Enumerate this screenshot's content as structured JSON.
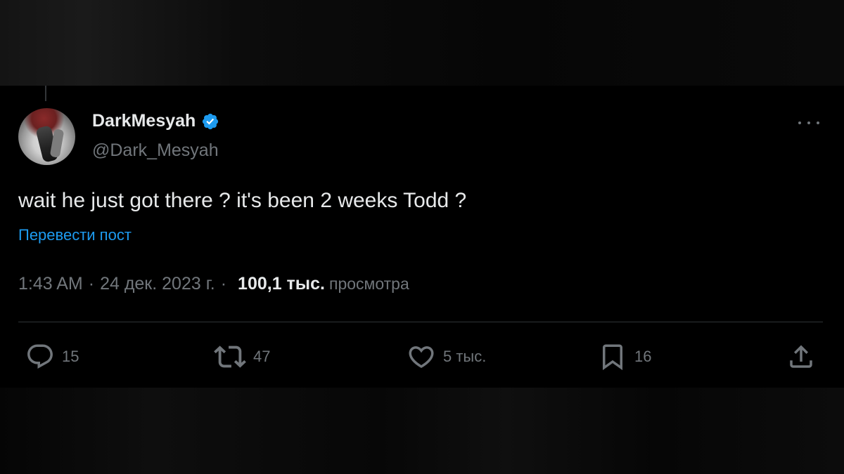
{
  "colors": {
    "background": "#000000",
    "text_primary": "#e7e9ea",
    "text_secondary": "#71767b",
    "link": "#1d9bf0",
    "verified_badge": "#1d9bf0",
    "divider": "#2f3336"
  },
  "author": {
    "display_name": "DarkMesyah",
    "handle": "@Dark_Mesyah",
    "verified": true,
    "avatar_icon": "avatar-image",
    "badge_icon": "verified-badge-icon"
  },
  "menu": {
    "icon": "more-options-icon"
  },
  "post": {
    "text": "wait he just got there ? it's been 2 weeks Todd ?",
    "translate_label": "Перевести пост"
  },
  "meta": {
    "time": "1:43 AM",
    "separator": "·",
    "date": "24 дек. 2023 г.",
    "views_count": "100,1 тыс.",
    "views_label": "просмотра"
  },
  "actions": {
    "reply": {
      "icon": "reply-icon",
      "count": "15"
    },
    "repost": {
      "icon": "repost-icon",
      "count": "47"
    },
    "like": {
      "icon": "heart-icon",
      "count": "5 тыс."
    },
    "bookmark": {
      "icon": "bookmark-icon",
      "count": "16"
    },
    "share": {
      "icon": "share-icon"
    }
  }
}
